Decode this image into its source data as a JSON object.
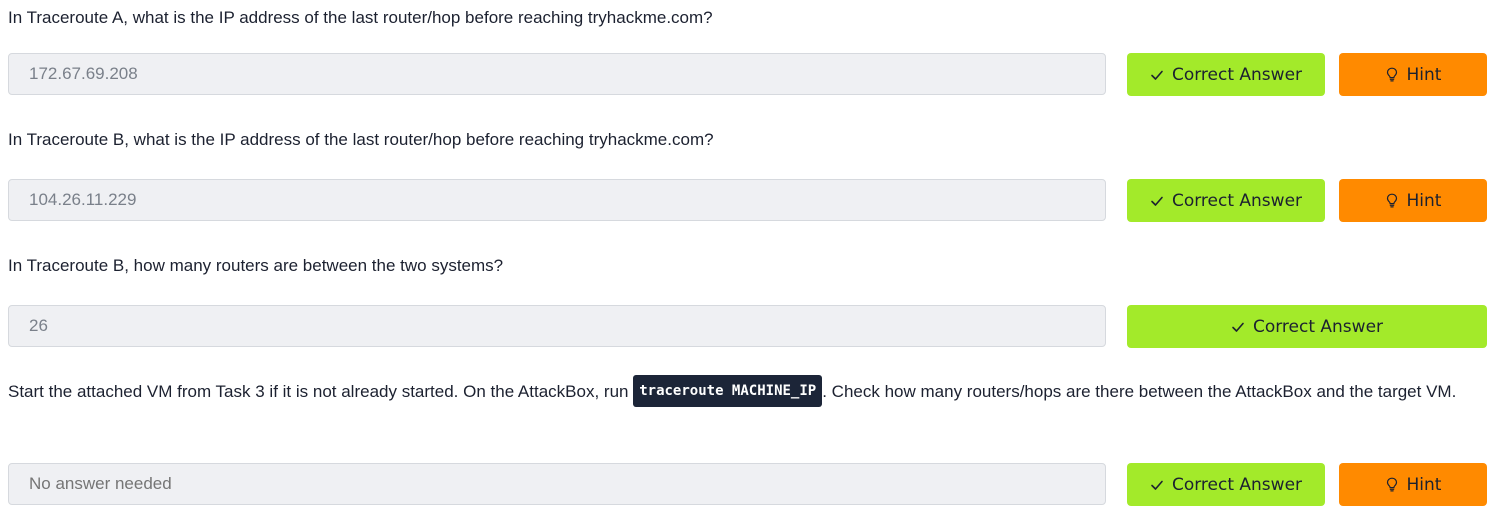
{
  "questions": [
    {
      "text": "In Traceroute A, what is the IP address of the last router/hop before reaching tryhackme.com?",
      "answer": "172.67.69.208",
      "correct_label": "Correct Answer",
      "hint_label": "Hint"
    },
    {
      "text": "In Traceroute B, what is the IP address of the last router/hop before reaching tryhackme.com?",
      "answer": "104.26.11.229",
      "correct_label": "Correct Answer",
      "hint_label": "Hint"
    },
    {
      "text": "In Traceroute B, how many routers are between the two systems?",
      "answer": "26",
      "correct_label": "Correct Answer"
    },
    {
      "text_before": "Start the attached VM from Task 3 if it is not already started. On the AttackBox, run ",
      "code": "traceroute MACHINE_IP",
      "text_after": ". Check how many routers/hops are there between the AttackBox and the target VM.",
      "placeholder": "No answer needed",
      "correct_label": "Correct Answer",
      "hint_label": "Hint"
    }
  ],
  "colors": {
    "correct_button": "#a3ea2a",
    "hint_button": "#ff8a00",
    "field_background": "#eff0f3",
    "code_background": "#1c2538"
  },
  "icons": {
    "correct": "check-icon",
    "hint": "lightbulb-icon"
  }
}
